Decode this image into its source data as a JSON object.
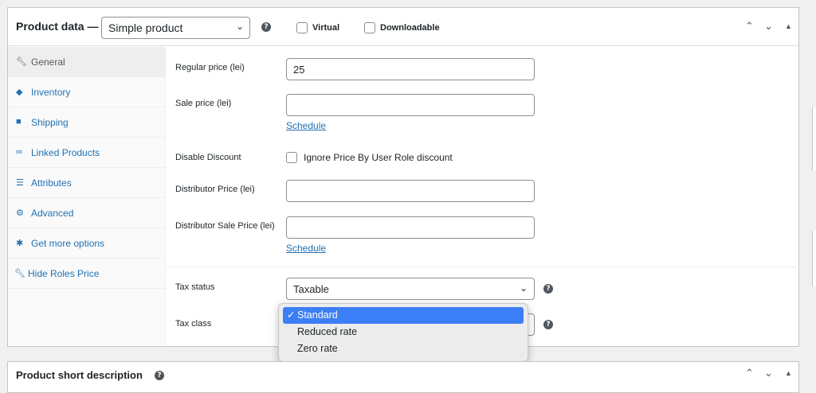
{
  "header": {
    "title": "Product data —",
    "product_type": "Simple product",
    "help_glyph": "?",
    "virtual_label": "Virtual",
    "downloadable_label": "Downloadable"
  },
  "sidebar": {
    "items": [
      {
        "label": "General",
        "icon": "wrench-icon"
      },
      {
        "label": "Inventory",
        "icon": "tag-icon"
      },
      {
        "label": "Shipping",
        "icon": "truck-icon"
      },
      {
        "label": "Linked Products",
        "icon": "link-icon"
      },
      {
        "label": "Attributes",
        "icon": "list-icon"
      },
      {
        "label": "Advanced",
        "icon": "gear-icon"
      },
      {
        "label": "Get more options",
        "icon": "plugin-icon"
      },
      {
        "label": "Hide Roles Price",
        "icon": "wrench-icon"
      }
    ]
  },
  "general": {
    "regular_price_label": "Regular price (lei)",
    "regular_price_value": "25",
    "sale_price_label": "Sale price (lei)",
    "sale_price_value": "",
    "schedule_label": "Schedule",
    "disable_discount_label": "Disable Discount",
    "ignore_price_label": "Ignore Price By User Role discount",
    "distributor_price_label": "Distributor Price (lei)",
    "distributor_sale_price_label": "Distributor Sale Price (lei)",
    "tax_status_label": "Tax status",
    "tax_status_value": "Taxable",
    "tax_class_label": "Tax class"
  },
  "tax_class_dropdown": {
    "options": [
      "Standard",
      "Reduced rate",
      "Zero rate"
    ],
    "selected": "Standard"
  },
  "short_description": {
    "title": "Product short description"
  }
}
